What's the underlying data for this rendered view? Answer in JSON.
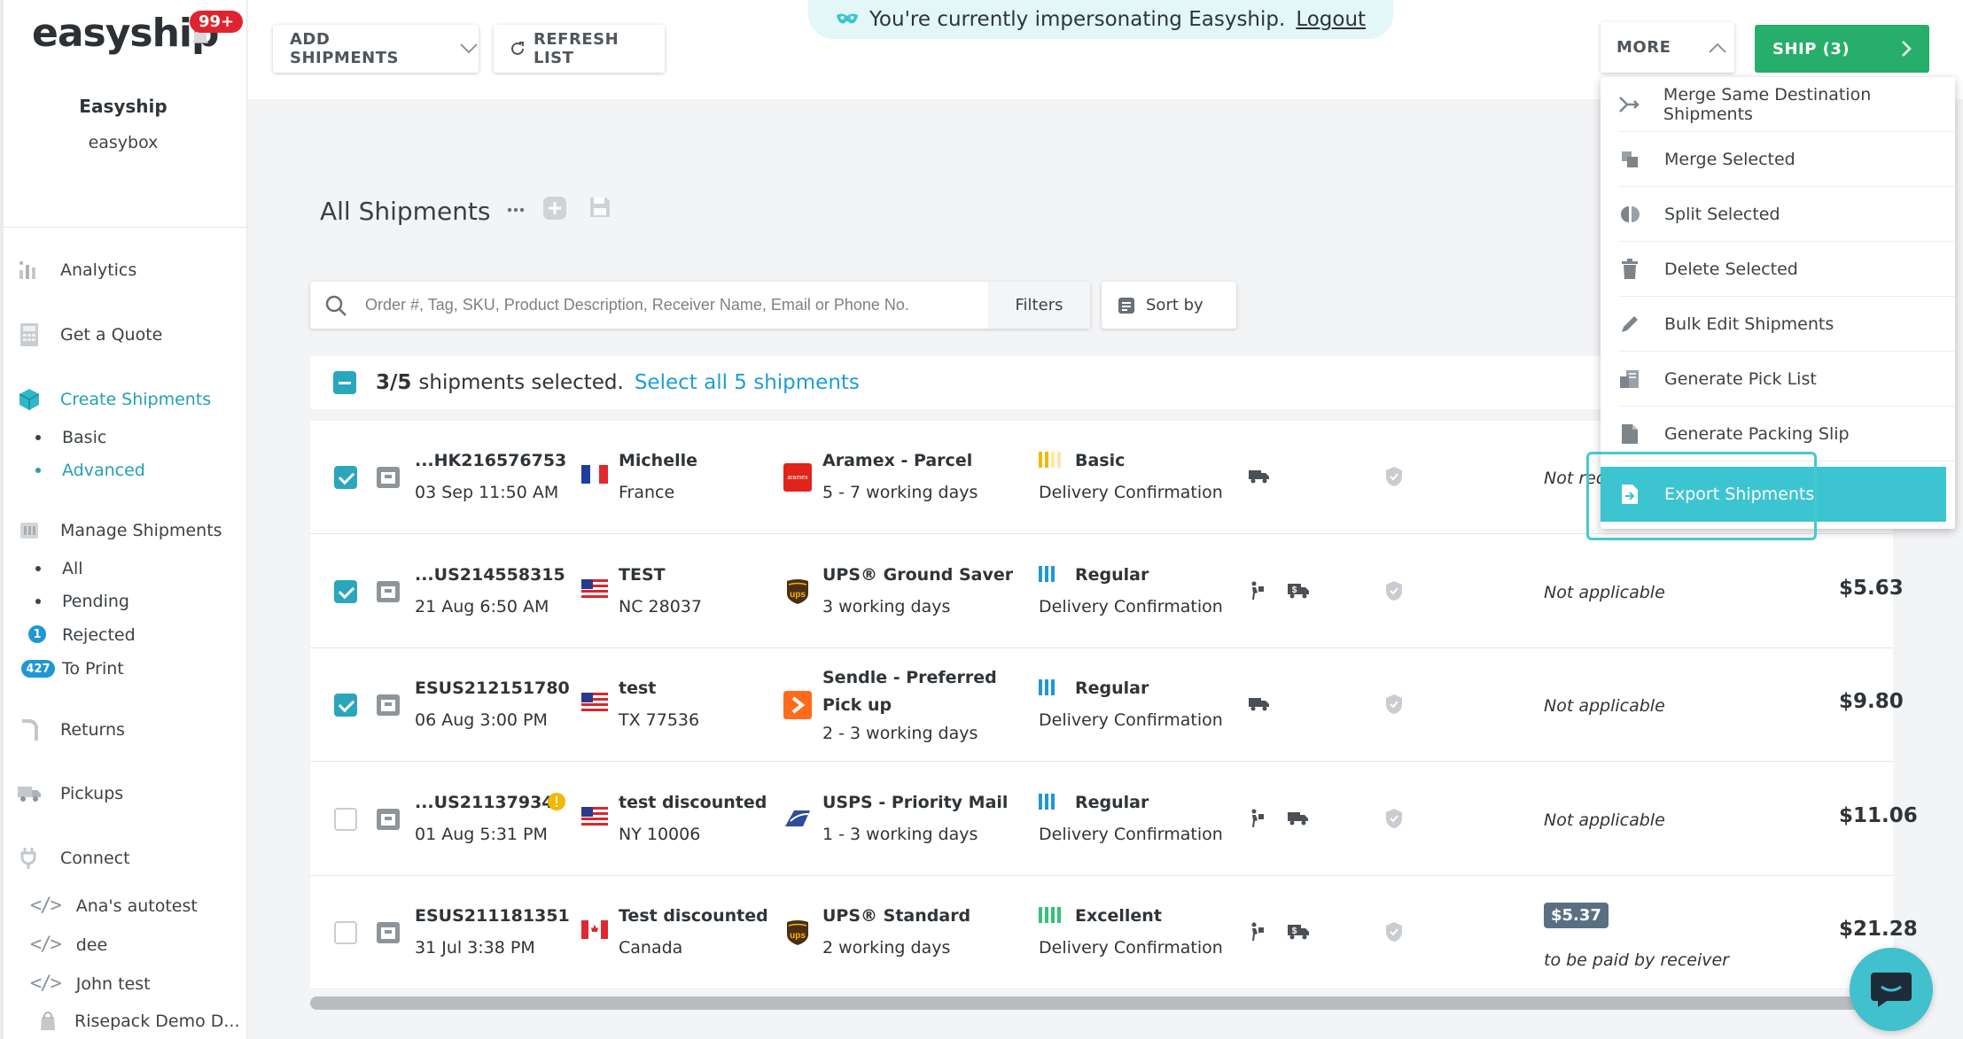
{
  "brand": {
    "logo": "easyship",
    "notifications": "99+"
  },
  "company": {
    "name": "Easyship",
    "sub": "easybox"
  },
  "sidebar": {
    "items": [
      {
        "label": "Analytics",
        "icon": "analytics-icon"
      },
      {
        "label": "Get a Quote",
        "icon": "calculator-icon"
      },
      {
        "label": "Create Shipments",
        "icon": "box-icon"
      },
      {
        "label": "Manage Shipments",
        "icon": "list-icon"
      },
      {
        "label": "Returns",
        "icon": "return-icon"
      },
      {
        "label": "Pickups",
        "icon": "truck-icon"
      },
      {
        "label": "Connect",
        "icon": "plug-icon"
      }
    ],
    "create_sub": [
      "Basic",
      "Advanced"
    ],
    "manage_sub": [
      "All",
      "Pending",
      "Rejected",
      "To Print"
    ],
    "rejected_count": "1",
    "to_print_count": "427",
    "connections": [
      "Ana's autotest",
      "dee",
      "John test",
      "Risepack Demo D..."
    ]
  },
  "toolbar": {
    "add_shipments": "ADD SHIPMENTS",
    "refresh_list": "REFRESH LIST",
    "impersonate_text": "You're currently impersonating Easyship.",
    "logout": "Logout",
    "more": "MORE",
    "ship": "SHIP (3)"
  },
  "page": {
    "title": "All Shipments"
  },
  "search": {
    "placeholder": "Order #, Tag, SKU, Product Description, Receiver Name, Email or Phone No.",
    "filters": "Filters",
    "sort_by": "Sort by"
  },
  "selection": {
    "count": "3/5",
    "text": "shipments selected.",
    "select_all": "Select all 5 shipments"
  },
  "rows": [
    {
      "selected": true,
      "id": "...HK216576753",
      "date": "03 Sep 11:50 AM",
      "name": "Michelle",
      "location": "France",
      "flag": "fr",
      "courier": "Aramex - Parcel",
      "courier_icon": "aramex",
      "transit": "5 - 7 working days",
      "rating": "Basic",
      "rating_color": "#f5b700",
      "rating_bars": 2,
      "delivery": "Delivery Confirmation",
      "icons": [
        "truck"
      ],
      "tax": "Not req",
      "price": ""
    },
    {
      "selected": true,
      "id": "...US214558315",
      "date": "21 Aug 6:50 AM",
      "name": "TEST",
      "location": "NC 28037",
      "flag": "us",
      "courier": "UPS® Ground Saver",
      "courier_icon": "ups",
      "transit": "3 working days",
      "rating": "Regular",
      "rating_color": "#1f97d4",
      "rating_bars": 3,
      "delivery": "Delivery Confirmation",
      "icons": [
        "dropoff",
        "truck-dollar"
      ],
      "tax": "Not applicable",
      "price": "$5.63"
    },
    {
      "selected": true,
      "id": "ESUS212151780",
      "date": "06 Aug 3:00 PM",
      "name": "test",
      "location": "TX 77536",
      "flag": "us",
      "courier": "Sendle - Preferred Pick up",
      "courier_icon": "sendle",
      "transit": "2 - 3 working days",
      "rating": "Regular",
      "rating_color": "#1f97d4",
      "rating_bars": 3,
      "delivery": "Delivery Confirmation",
      "icons": [
        "truck"
      ],
      "tax": "Not applicable",
      "price": "$9.80"
    },
    {
      "selected": false,
      "id": "...US211379346",
      "date": "01 Aug 5:31 PM",
      "name": "test discounted",
      "location": "NY 10006",
      "flag": "us",
      "courier": "USPS - Priority Mail",
      "courier_icon": "usps",
      "transit": "1 - 3 working days",
      "rating": "Regular",
      "rating_color": "#1f97d4",
      "rating_bars": 3,
      "delivery": "Delivery Confirmation",
      "icons": [
        "dropoff",
        "truck"
      ],
      "tax": "Not applicable",
      "price": "$11.06",
      "warning": true
    },
    {
      "selected": false,
      "id": "ESUS211181351",
      "date": "31 Jul 3:38 PM",
      "name": "Test discounted",
      "location": "Canada",
      "flag": "ca",
      "courier": "UPS® Standard",
      "courier_icon": "ups",
      "transit": "2 working days",
      "rating": "Excellent",
      "rating_color": "#36c07a",
      "rating_bars": 4,
      "delivery": "Delivery Confirmation",
      "icons": [
        "dropoff",
        "truck-dollar"
      ],
      "tax_tag": "$5.37",
      "tax": "to be paid by receiver",
      "price": "$21.28"
    }
  ],
  "more_menu": [
    {
      "label": "Merge Same Destination Shipments",
      "icon": "merge-arrow-icon"
    },
    {
      "label": "Merge Selected",
      "icon": "merge-icon"
    },
    {
      "label": "Split Selected",
      "icon": "split-icon"
    },
    {
      "label": "Delete Selected",
      "icon": "trash-icon"
    },
    {
      "label": "Bulk Edit Shipments",
      "icon": "pencil-icon"
    },
    {
      "label": "Generate Pick List",
      "icon": "pick-list-icon"
    },
    {
      "label": "Generate Packing Slip",
      "icon": "document-icon"
    },
    {
      "label": "Export Shipments",
      "icon": "export-icon"
    }
  ],
  "colors": {
    "accent": "#2aa6bd",
    "ship": "#27ae6a",
    "link": "#1f9dd6",
    "active_menu": "#3cc5d0"
  }
}
